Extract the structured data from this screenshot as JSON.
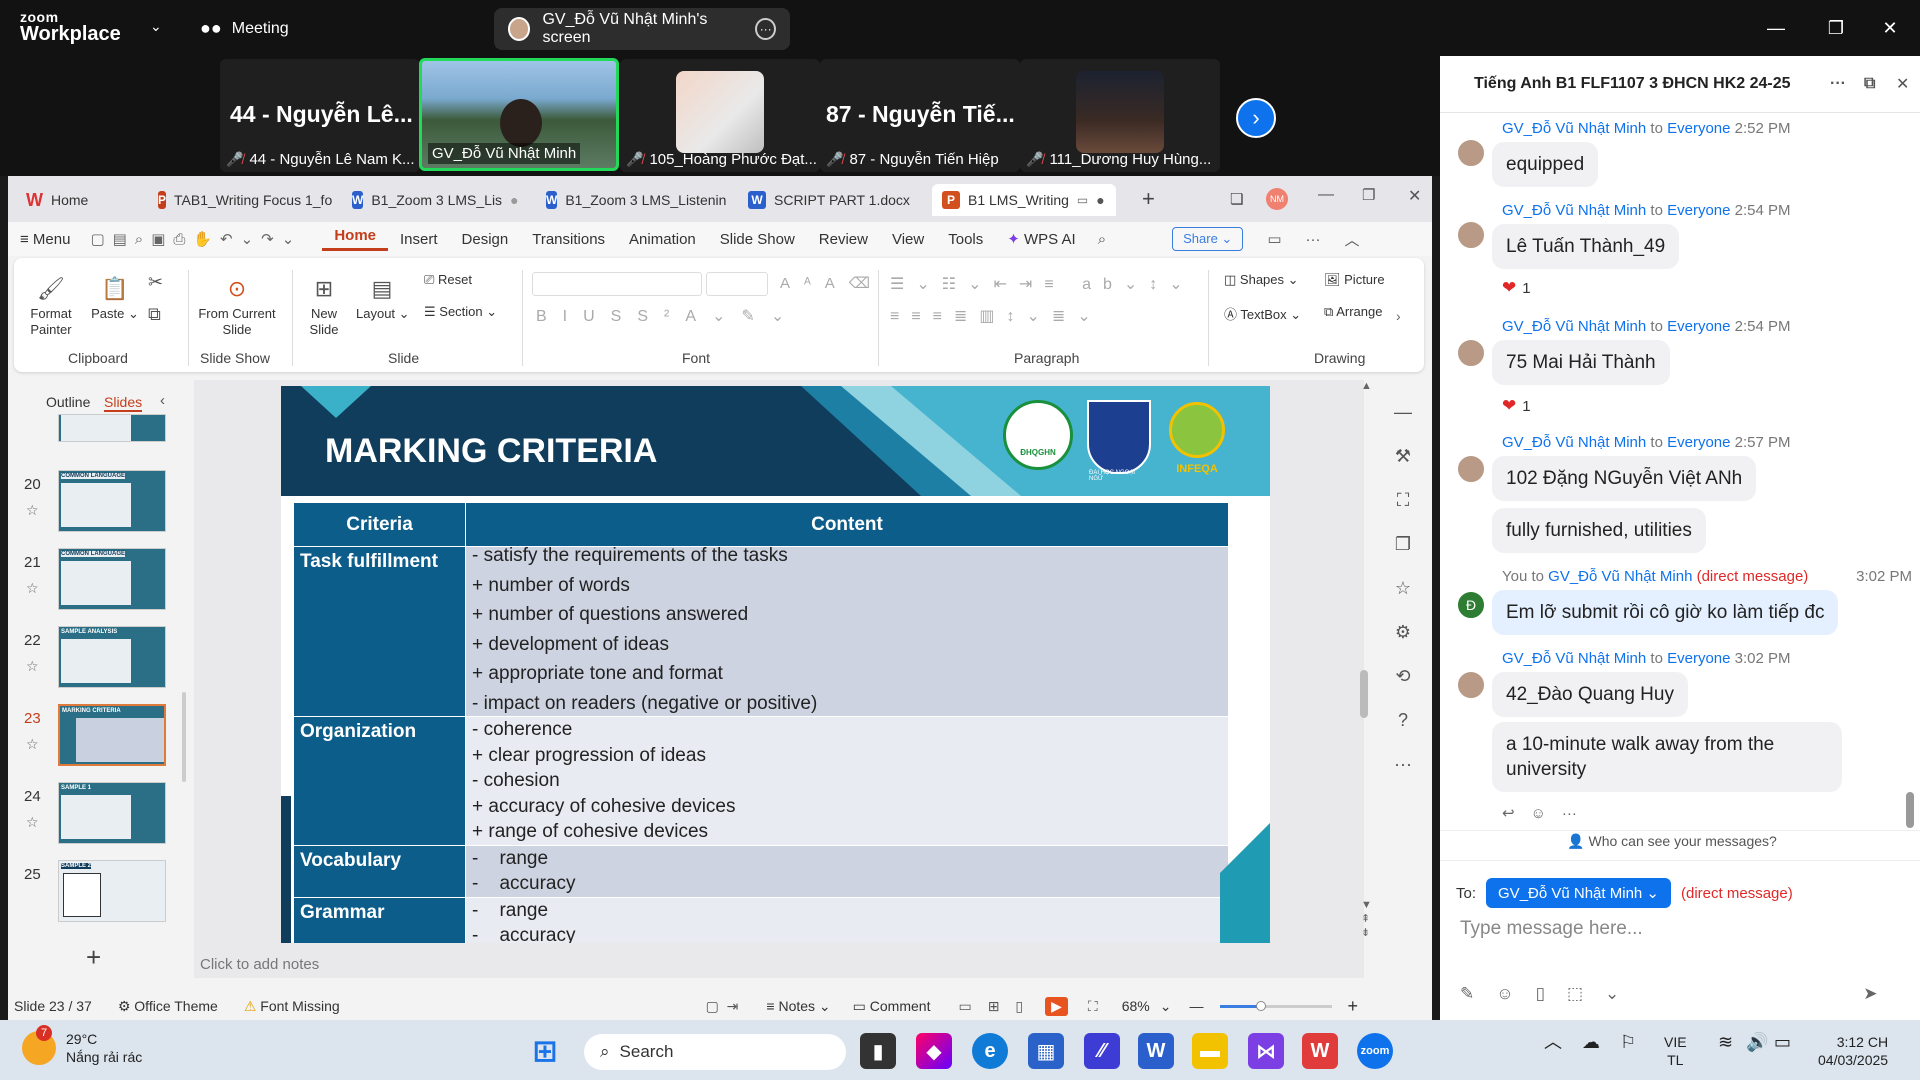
{
  "zoom": {
    "brand_line1": "zoom",
    "brand_line2": "Workplace",
    "meeting_label": "Meeting",
    "share_label": "GV_Đỗ Vũ Nhật Minh's screen",
    "tiles": [
      {
        "big": "44 - Nguyễn Lê...",
        "caption": "44 - Nguyễn Lê Nam K..."
      },
      {
        "big": "",
        "caption": "GV_Đỗ Vũ Nhật Minh"
      },
      {
        "big": "",
        "caption": "105_Hoàng Phước Đạt..."
      },
      {
        "big": "87 - Nguyễn Tiế...",
        "caption": "87 - Nguyễn Tiến Hiệp"
      },
      {
        "big": "",
        "caption": "111_Dương Huy Hùng..."
      }
    ]
  },
  "wps": {
    "tabs": [
      "Home",
      "TAB1_Writing Focus 1_fo",
      "B1_Zoom 3 LMS_Lis",
      "B1_Zoom 3 LMS_Listenin",
      "SCRIPT PART 1.docx",
      "B1 LMS_Writing"
    ],
    "avatar_initials": "NM",
    "menu": [
      "Menu",
      "Home",
      "Insert",
      "Design",
      "Transitions",
      "Animation",
      "Slide Show",
      "Review",
      "View",
      "Tools",
      "WPS AI"
    ],
    "share_btn": "Share",
    "ribbon": {
      "format_painter": "Format Painter",
      "paste": "Paste",
      "clipboard": "Clipboard",
      "from_current": "From Current Slide",
      "slide_show": "Slide Show",
      "new_slide": "New Slide",
      "layout": "Layout",
      "reset": "Reset",
      "section": "Section",
      "slide": "Slide",
      "font": "Font",
      "paragraph": "Paragraph",
      "shapes": "Shapes",
      "picture": "Picture",
      "textbox": "TextBox",
      "arrange": "Arrange",
      "drawing": "Drawing"
    },
    "pane": {
      "outline": "Outline",
      "slides": "Slides"
    },
    "thumbs": [
      {
        "num": "20",
        "title": "COMMON LANGUAGE"
      },
      {
        "num": "21",
        "title": "COMMON LANGUAGE"
      },
      {
        "num": "22",
        "title": "SAMPLE ANALYSIS"
      },
      {
        "num": "23",
        "title": "MARKING CRITERIA"
      },
      {
        "num": "24",
        "title": "SAMPLE 1"
      },
      {
        "num": "25",
        "title": "SAMPLE 2"
      }
    ],
    "slide": {
      "title": "MARKING CRITERIA",
      "col1": "Criteria",
      "col2": "Content",
      "rows": [
        {
          "name": "Task fulfillment",
          "lines": [
            "- satisfy the requirements of the tasks",
            "+ number of words",
            "+ number of questions answered",
            "+ development of ideas",
            "+ appropriate tone and format",
            "-   impact on readers (negative or positive)"
          ]
        },
        {
          "name": "Organization",
          "lines": [
            "- coherence",
            "+ clear progression of ideas",
            "- cohesion",
            "+ accuracy of cohesive devices",
            "+ range of cohesive devices"
          ]
        },
        {
          "name": "Vocabulary",
          "lines": [
            "-    range",
            "-    accuracy"
          ]
        },
        {
          "name": "Grammar",
          "lines": [
            "-    range",
            "-    accuracy"
          ]
        }
      ],
      "logos": [
        "ĐHQGHN",
        "ĐẠI HỌC NGOẠI NGỮ",
        "INFEQA"
      ]
    },
    "notes_placeholder": "Click to add notes",
    "status": {
      "slide_count": "Slide 23 / 37",
      "theme": "Office Theme",
      "font_missing": "Font Missing",
      "notes": "Notes",
      "comment": "Comment",
      "zoom": "68%"
    }
  },
  "chat": {
    "title": "Tiếng Anh B1 FLF1107 3 ĐHCN HK2 24-25",
    "messages": [
      {
        "sender": "GV_Đỗ Vũ Nhật Minh",
        "to": "to",
        "recipient": "Everyone",
        "time": "2:52 PM",
        "bubbles": [
          "equipped"
        ]
      },
      {
        "sender": "GV_Đỗ Vũ Nhật Minh",
        "to": "to",
        "recipient": "Everyone",
        "time": "2:54 PM",
        "bubbles": [
          "Lê Tuấn Thành_49"
        ],
        "reaction": "1"
      },
      {
        "sender": "GV_Đỗ Vũ Nhật Minh",
        "to": "to",
        "recipient": "Everyone",
        "time": "2:54 PM",
        "bubbles": [
          "75 Mai Hải Thành"
        ],
        "reaction": "1"
      },
      {
        "sender": "GV_Đỗ Vũ Nhật Minh",
        "to": "to",
        "recipient": "Everyone",
        "time": "2:57 PM",
        "bubbles": [
          "102 Đặng NGuyễn Việt ANh",
          "fully furnished, utilities"
        ]
      },
      {
        "sender": "You",
        "to": "to",
        "recipient": "GV_Đỗ Vũ Nhật Minh",
        "note": "(direct message)",
        "time": "3:02 PM",
        "bubbles": [
          "Em lỡ submit rồi cô giờ ko làm tiếp đc"
        ],
        "avatar_letter": "Đ"
      },
      {
        "sender": "GV_Đỗ Vũ Nhật Minh",
        "to": "to",
        "recipient": "Everyone",
        "time": "3:02 PM",
        "bubbles": [
          "42_Đào Quang Huy",
          "a 10-minute walk away from the university"
        ]
      }
    ],
    "who_can_see": "Who can see your messages?",
    "to_label": "To:",
    "to_value": "GV_Đỗ Vũ Nhật Minh",
    "to_note": "(direct message)",
    "placeholder": "Type message here..."
  },
  "taskbar": {
    "temp": "29°C",
    "weather": "Nắng rải rác",
    "weather_badge": "7",
    "search": "Search",
    "lang1": "VIE",
    "lang2": "TL",
    "time": "3:12 CH",
    "date": "04/03/2025"
  }
}
